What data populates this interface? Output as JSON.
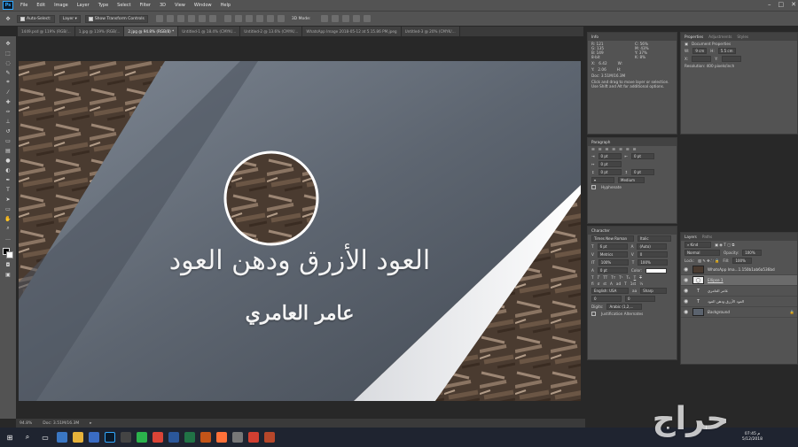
{
  "app": {
    "logo": "Ps"
  },
  "menu": [
    "File",
    "Edit",
    "Image",
    "Layer",
    "Type",
    "Select",
    "Filter",
    "3D",
    "View",
    "Window",
    "Help"
  ],
  "options": {
    "auto_select": "Auto-Select:",
    "layer": "Layer",
    "transform": "Show Transform Controls",
    "mode3d": "3D Mode:"
  },
  "tabs": [
    {
      "label": "1449.psd @ 119% (RGB/...",
      "active": false
    },
    {
      "label": "1.jpg @ 119% (RGB/...",
      "active": false
    },
    {
      "label": "2.jpg @ 94.8% (RGB/8) *",
      "active": true
    },
    {
      "label": "Untitled-1 @ 18.4% (CMYK/...",
      "active": false
    },
    {
      "label": "Untitled-2 @ 13.6% (CMYK/...",
      "active": false
    },
    {
      "label": "WhatsApp Image 2018-05-12 at 5.15.86 PM.jpeg",
      "active": false
    },
    {
      "label": "Untitled-3 @ 20% (CMYK/...",
      "active": false
    }
  ],
  "canvas": {
    "title": "العود الأزرق ودهن العود",
    "subtitle": "عامر العامري"
  },
  "status": {
    "zoom": "94.8%",
    "doc": "Doc: 3.51M/16.3M"
  },
  "info": {
    "tab": "Info",
    "rgb": [
      "R:",
      "G:",
      "B:"
    ],
    "rgb_vals": [
      "121",
      "135",
      "149"
    ],
    "cmyk": [
      "C:",
      "M:",
      "Y:",
      "K:"
    ],
    "cmyk_vals": [
      "56%",
      "43%",
      "37%",
      "8%"
    ],
    "bits": "8-bit",
    "x_label": "X:",
    "y_label": "Y:",
    "x_val": "6.42",
    "y_val": "2.06",
    "w_label": "W:",
    "h_label": "H:",
    "doc": "Doc: 3.51M/16.3M",
    "hint": "Click and drag to move layer or selection. Use Shift and Alt for additional options."
  },
  "properties": {
    "tabs": [
      "Properties",
      "Adjustments",
      "Styles"
    ],
    "doc_title": "Document Properties",
    "w_label": "W:",
    "w_val": "9 cm",
    "h_label": "H:",
    "h_val": "5.5 cm",
    "x_label": "X:",
    "y_label": "Y:",
    "res": "Resolution: 400 pixels/inch"
  },
  "paragraph": {
    "tab": "Paragraph",
    "indents": [
      "0 pt",
      "0 pt",
      "0 pt"
    ],
    "spaces": [
      "0 pt",
      "0 pt"
    ],
    "justification": "Medium",
    "hyphenate": "Hyphenate"
  },
  "character": {
    "tab": "Character",
    "font": "Times New Roman",
    "style": "Italic",
    "size": "6 pt",
    "leading": "(Auto)",
    "kerning": "Metrics",
    "tracking": "0",
    "vscale": "100%",
    "hscale": "100%",
    "baseline": "0 pt",
    "color_label": "Color:",
    "language": "English: USA",
    "aa": "Sharp",
    "digits": "Digits:",
    "digits_val": "Arabic (1,2,...",
    "justif": "Justification Alternates"
  },
  "layers": {
    "tabs": [
      "Layers",
      "Paths"
    ],
    "kind": "Kind",
    "mode": "Normal",
    "opacity_label": "Opacity:",
    "opacity": "100%",
    "lock_label": "Lock:",
    "fill_label": "Fill:",
    "fill": "100%",
    "rows": [
      {
        "name": "WhatsApp Ima...1.150b1ab6a536bd",
        "type": "image",
        "selected": false
      },
      {
        "name": "Ellipse 1",
        "type": "shape",
        "selected": true
      },
      {
        "name": "عامر العامري",
        "type": "text",
        "selected": false
      },
      {
        "name": "العود الأزرق ودهن العود",
        "type": "text",
        "selected": false
      },
      {
        "name": "Background",
        "type": "bg",
        "selected": false
      }
    ]
  },
  "taskbar": {
    "time": "07:45 م",
    "date": "5/12/2018"
  },
  "watermark": "حراج"
}
